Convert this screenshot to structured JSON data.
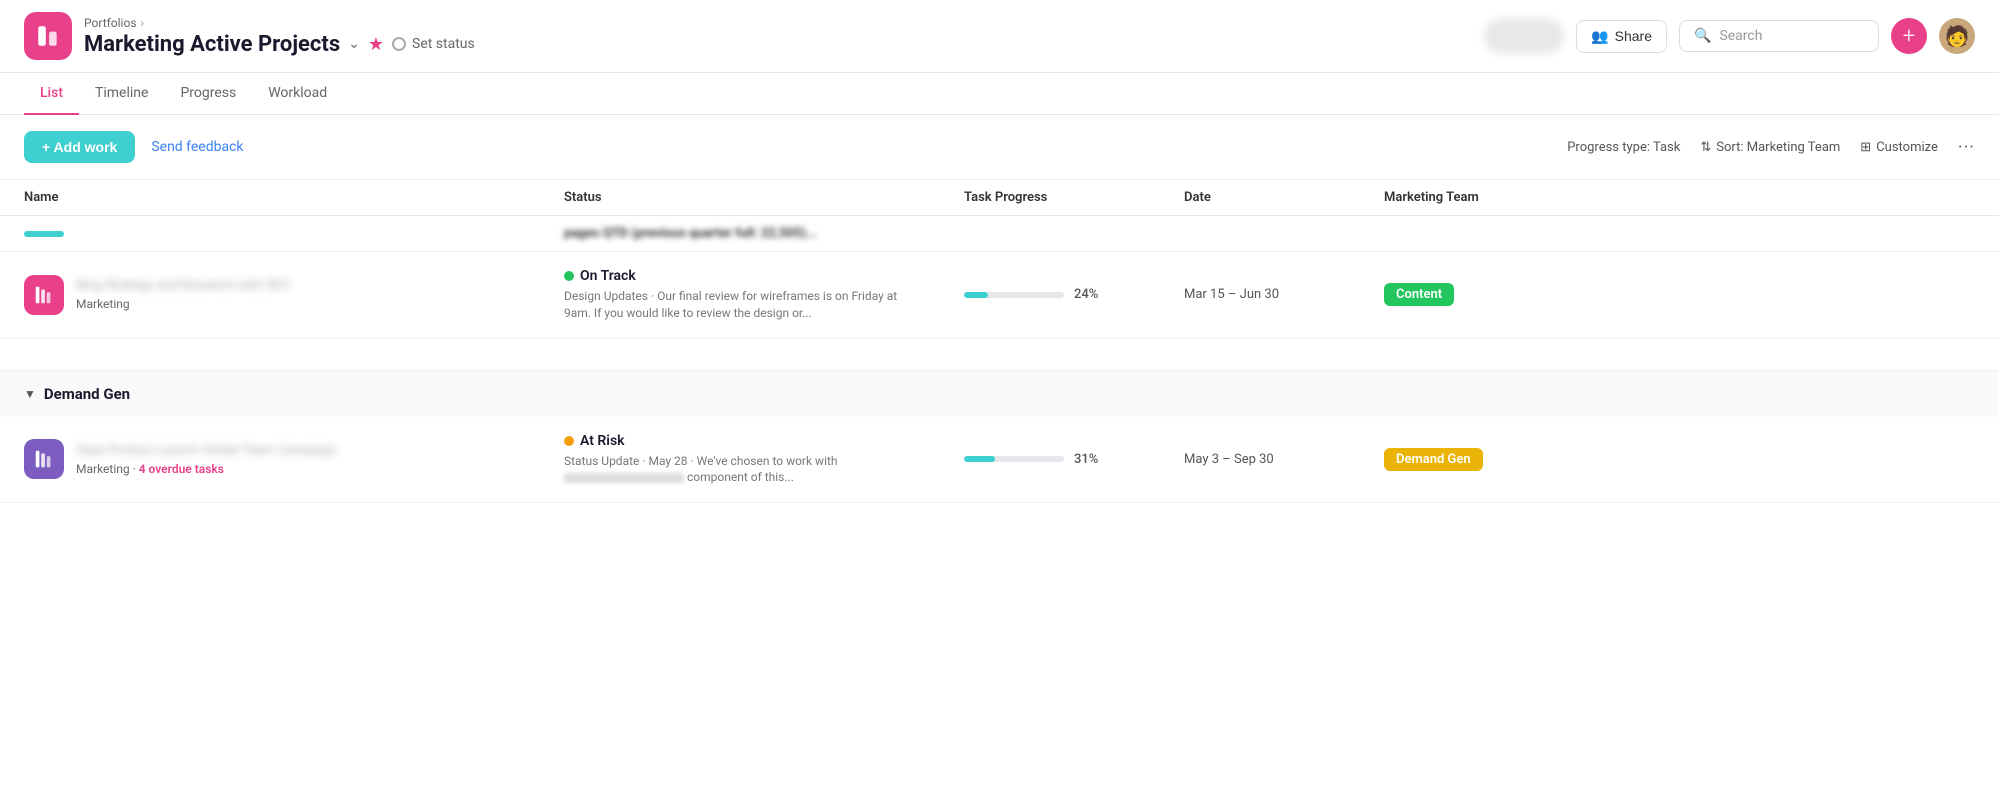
{
  "app": {
    "icon_unicode": "▦",
    "breadcrumb": "Portfolios",
    "title": "Marketing Active Projects",
    "set_status_label": "Set status"
  },
  "header": {
    "share_label": "Share",
    "search_placeholder": "Search",
    "add_label": "+"
  },
  "tabs": [
    {
      "id": "list",
      "label": "List",
      "active": true
    },
    {
      "id": "timeline",
      "label": "Timeline",
      "active": false
    },
    {
      "id": "progress",
      "label": "Progress",
      "active": false
    },
    {
      "id": "workload",
      "label": "Workload",
      "active": false
    }
  ],
  "toolbar": {
    "add_work_label": "+ Add work",
    "send_feedback_label": "Send feedback",
    "progress_type_label": "Progress type: Task",
    "sort_label": "Sort: Marketing Team",
    "customize_label": "Customize",
    "more_label": "···"
  },
  "table": {
    "columns": [
      "Name",
      "Status",
      "Task Progress",
      "Date",
      "Marketing Team"
    ],
    "partial_row": {
      "blurred_text": "pages QTD (previous quarter full: 22,505)..."
    },
    "sections": [
      {
        "id": "marketing",
        "name": "",
        "rows": [
          {
            "icon_color": "pink",
            "project_name_blurred": "Blog Strategy and Research with SEO",
            "team": "Marketing",
            "status_dot": "green",
            "status_label": "On Track",
            "status_desc": "Design Updates · Our final review for wireframes is on Friday at 9am. If you would like to review the design or...",
            "progress": 24,
            "date": "Mar 15 – Jun 30",
            "tag": "Content",
            "tag_color": "green-tag"
          }
        ]
      },
      {
        "id": "demand_gen",
        "name": "Demand Gen",
        "rows": [
          {
            "icon_color": "purple",
            "project_name_blurred": "Saas Product Launch Global Team Campaign",
            "team": "Marketing",
            "overdue": "4 overdue tasks",
            "status_dot": "orange",
            "status_label": "At Risk",
            "status_desc": "Status Update · May 28 · We've chosen to work with                           component of this...",
            "progress": 31,
            "date": "May 3 – Sep 30",
            "tag": "Demand Gen",
            "tag_color": "yellow-tag"
          }
        ]
      }
    ]
  }
}
